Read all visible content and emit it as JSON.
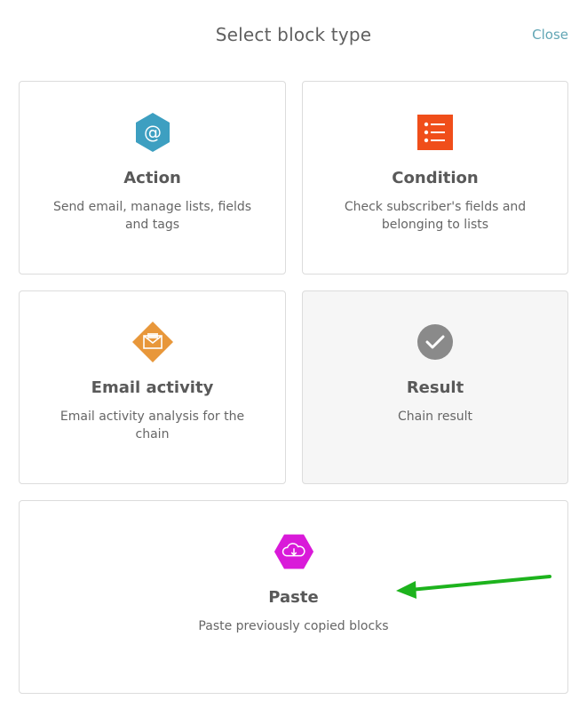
{
  "dialog": {
    "title": "Select block type",
    "close_label": "Close"
  },
  "blocks": [
    {
      "id": "action",
      "title": "Action",
      "description": "Send email, manage lists, fields and tags",
      "icon": "at-sign-hexagon-icon",
      "color": "#3d9fc1"
    },
    {
      "id": "condition",
      "title": "Condition",
      "description": "Check subscriber's fields and belonging to lists",
      "icon": "list-square-icon",
      "color": "#f04e1a"
    },
    {
      "id": "email_activity",
      "title": "Email activity",
      "description": "Email activity analysis for the chain",
      "icon": "envelope-diamond-icon",
      "color": "#e8973a"
    },
    {
      "id": "result",
      "title": "Result",
      "description": "Chain result",
      "icon": "checkmark-circle-icon",
      "color": "#8a8a8a"
    },
    {
      "id": "paste",
      "title": "Paste",
      "description": "Paste previously copied blocks",
      "icon": "cloud-download-hexagon-icon",
      "color": "#d91ad9"
    }
  ],
  "annotation": {
    "arrow_color": "#1db31d"
  }
}
